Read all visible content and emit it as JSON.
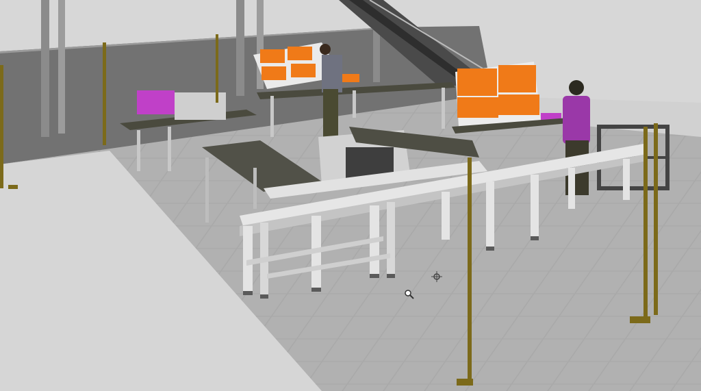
{
  "scene": {
    "type": "3d-factory-assembly-line-simulation",
    "objects": [
      "floor-grid",
      "back-wall-fence",
      "mezzanine-stairs",
      "roller-conveyor",
      "assembly-workbench",
      "parts-rack-orange-bins",
      "operator-figure",
      "safety-light-pole",
      "service-cart"
    ]
  },
  "colors": {
    "floor": "#a7a7a7",
    "floor_light": "#c2c2c2",
    "walkway": "#d9d9d9",
    "fence": "#6e6e6e",
    "frame": "#e6e6e6",
    "frame_shadow": "#b9b9b9",
    "bench_top": "#4e4e44",
    "bin_orange": "#f07a18",
    "magenta": "#c040c8",
    "pole": "#7c6a1a",
    "worker_shirt": "#9a38a8",
    "worker_dark": "#3c3a2c"
  },
  "icons": {
    "pivot": "crosshair-pivot-icon",
    "cursor": "magnifier-cursor-icon"
  }
}
